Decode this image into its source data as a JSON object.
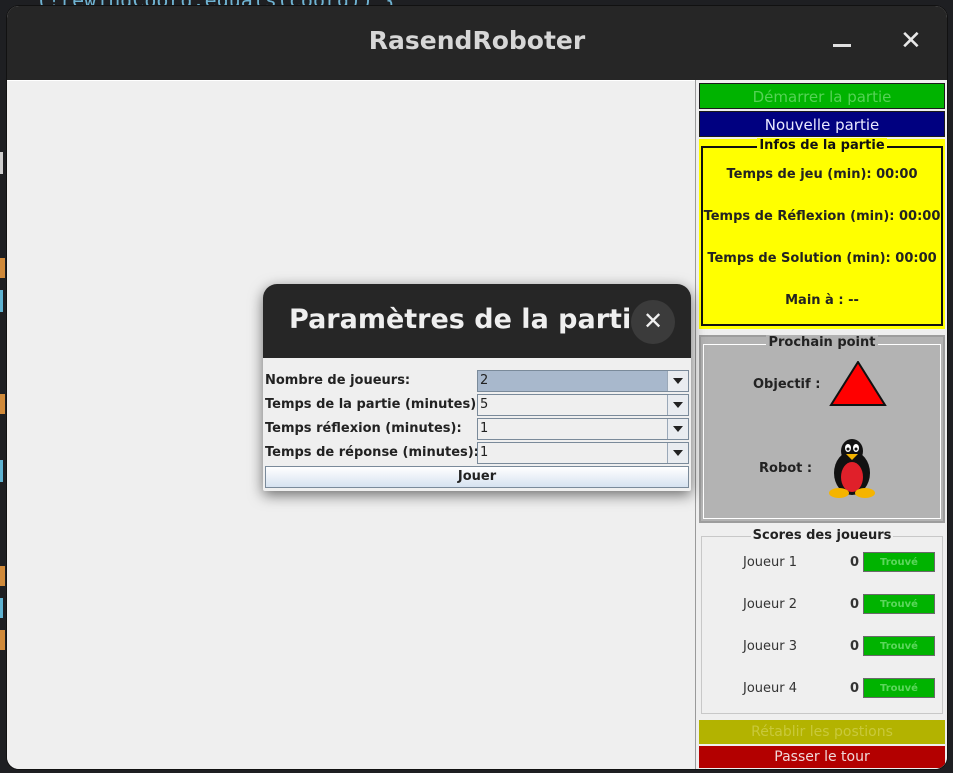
{
  "background_code": {
    "top_line": "(!rewindCoord.equals(coord)) {"
  },
  "window": {
    "title": "RasendRoboter"
  },
  "panel": {
    "start_button": "Démarrer la partie",
    "new_game_button": "Nouvelle partie",
    "infos": {
      "legend": "Infos de la partie",
      "rows": [
        "Temps de jeu (min):  00:00",
        "Temps de Réflexion (min):  00:00",
        "Temps de Solution (min):  00:00",
        "Main à :  --"
      ]
    },
    "next_point": {
      "legend": "Prochain point",
      "objective_label": "Objectif :",
      "robot_label": "Robot :",
      "objective_color": "#ff0000"
    },
    "scores": {
      "legend": "Scores des joueurs",
      "players": [
        {
          "name": "Joueur 1",
          "score": "0",
          "found_label": "Trouvé"
        },
        {
          "name": "Joueur 2",
          "score": "0",
          "found_label": "Trouvé"
        },
        {
          "name": "Joueur 3",
          "score": "0",
          "found_label": "Trouvé"
        },
        {
          "name": "Joueur 4",
          "score": "0",
          "found_label": "Trouvé"
        }
      ]
    },
    "reset_button": "Rétablir les postions",
    "pass_button": "Passer le tour"
  },
  "dialog": {
    "title": "Paramètres de la partie",
    "rows": [
      {
        "label": "Nombre de joueurs:",
        "value": "2"
      },
      {
        "label": "Temps de la partie (minutes):",
        "value": "5"
      },
      {
        "label": "Temps réflexion (minutes):",
        "value": "1"
      },
      {
        "label": "Temps de réponse (minutes):",
        "value": "1"
      }
    ],
    "play_button": "Jouer"
  }
}
